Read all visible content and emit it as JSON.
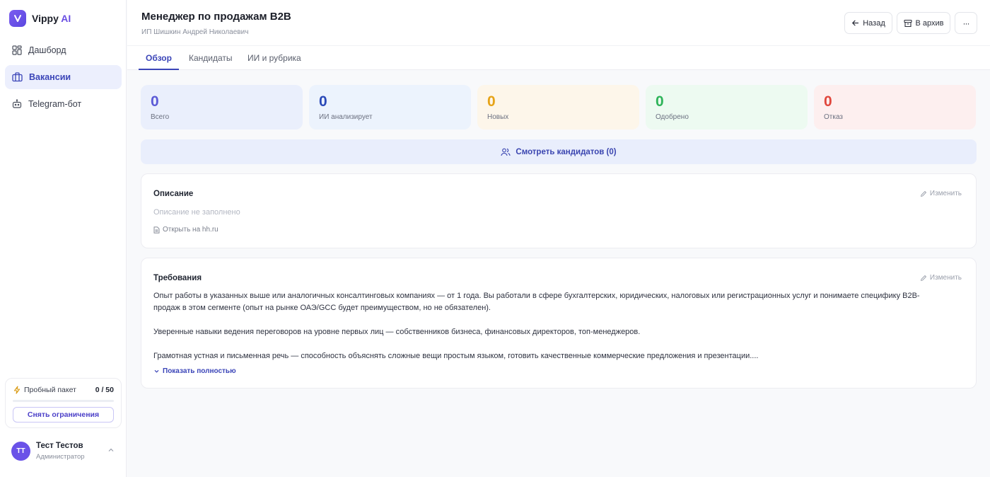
{
  "brand": {
    "name": "Vippy",
    "ai": "AI"
  },
  "nav": [
    {
      "label": "Дашборд",
      "icon": "grid-icon",
      "active": false
    },
    {
      "label": "Вакансии",
      "icon": "briefcase-icon",
      "active": true
    },
    {
      "label": "Telegram-бот",
      "icon": "bot-icon",
      "active": false
    }
  ],
  "trial": {
    "label": "Пробный пакет",
    "count": "0 / 50",
    "used_fraction": 0,
    "button": "Снять ограничения"
  },
  "user": {
    "initials": "ТТ",
    "name": "Тест Тестов",
    "role": "Администратор"
  },
  "header": {
    "title": "Менеджер по продажам B2B",
    "subtitle": "ИП Шишкин Андрей Николаевич",
    "back": "Назад",
    "archive": "В архив",
    "more": "···"
  },
  "tabs": [
    "Обзор",
    "Кандидаты",
    "ИИ и рубрика"
  ],
  "stats": [
    {
      "value": "0",
      "label": "Всего",
      "bg": "#eaeffc",
      "color": "#5b5ad6"
    },
    {
      "value": "0",
      "label": "ИИ анализирует",
      "bg": "#ecf3fd",
      "color": "#2a49b8"
    },
    {
      "value": "0",
      "label": "Новых",
      "bg": "#fdf6ea",
      "color": "#e6a317"
    },
    {
      "value": "0",
      "label": "Одобрено",
      "bg": "#edfaf1",
      "color": "#2fb45a"
    },
    {
      "value": "0",
      "label": "Отказ",
      "bg": "#fdefef",
      "color": "#e0463c"
    }
  ],
  "view_candidates": "Смотреть кандидатов (0)",
  "description": {
    "title": "Описание",
    "edit": "Изменить",
    "empty": "Описание не заполнено",
    "hh_link": "Открыть на hh.ru"
  },
  "requirements": {
    "title": "Требования",
    "edit": "Изменить",
    "paragraphs": [
      "Опыт работы в указанных выше или аналогичных консалтинговых компаниях — от 1 года. Вы работали в сфере бухгалтерских, юридических, налоговых или регистрационных услуг и понимаете специфику B2B-продаж в этом сегменте (опыт на рынке ОАЭ/GCC будет преимуществом, но не обязателен).",
      "Уверенные навыки ведения переговоров на уровне первых лиц — собственников бизнеса, финансовых директоров, топ-менеджеров.",
      "Грамотная устная и письменная речь — способность объяснять сложные вещи простым языком, готовить качественные коммерческие предложения и презентации...."
    ],
    "show_more": "Показать полностью"
  }
}
